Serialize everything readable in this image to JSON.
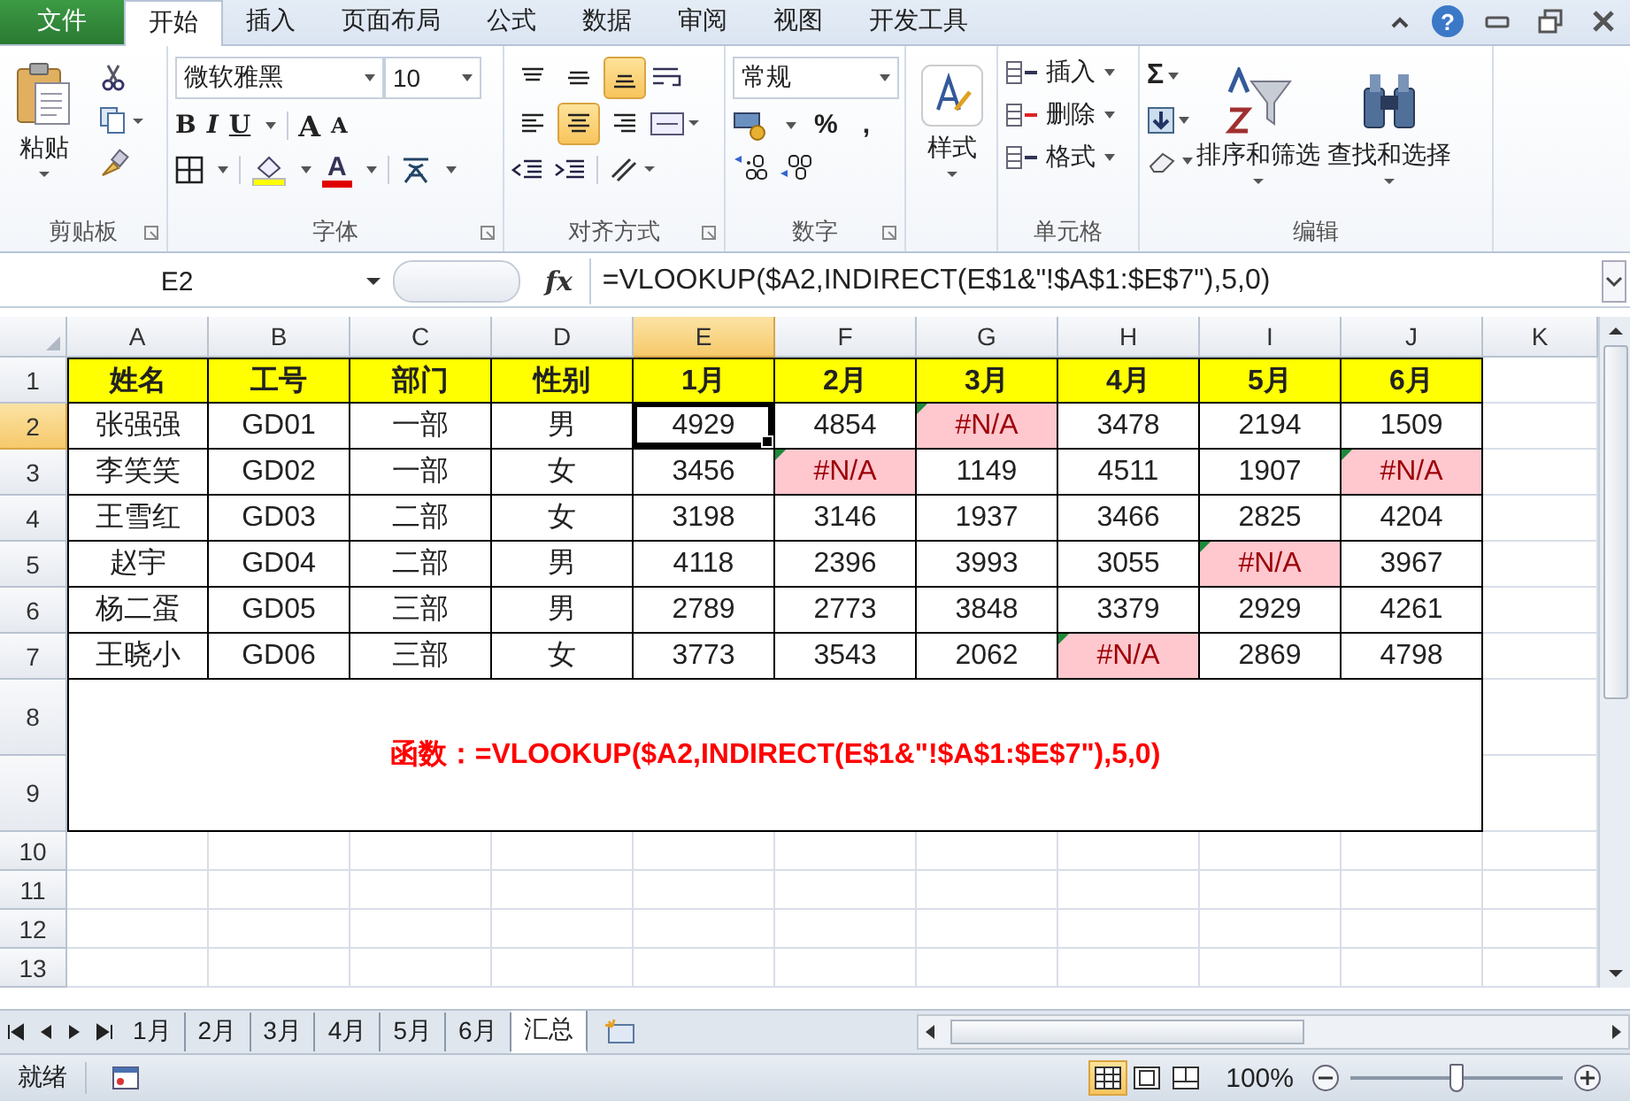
{
  "tabs": [
    {
      "label": "文件",
      "kind": "file",
      "selected": false
    },
    {
      "label": "开始",
      "kind": "tab",
      "selected": true
    },
    {
      "label": "插入",
      "kind": "tab",
      "selected": false
    },
    {
      "label": "页面布局",
      "kind": "tab",
      "selected": false
    },
    {
      "label": "公式",
      "kind": "tab",
      "selected": false
    },
    {
      "label": "数据",
      "kind": "tab",
      "selected": false
    },
    {
      "label": "审阅",
      "kind": "tab",
      "selected": false
    },
    {
      "label": "视图",
      "kind": "tab",
      "selected": false
    },
    {
      "label": "开发工具",
      "kind": "tab",
      "selected": false
    }
  ],
  "window_controls": {
    "help": "?"
  },
  "ribbon": {
    "clipboard": {
      "paste": "粘贴",
      "label": "剪贴板"
    },
    "font": {
      "name": "微软雅黑",
      "size": "10",
      "styles": [
        "B",
        "I",
        "U"
      ],
      "grow": "A",
      "shrink": "A",
      "font_color": "A",
      "label": "字体"
    },
    "alignment": {
      "buttons": [
        {
          "kind": "top",
          "selected": false
        },
        {
          "kind": "middle",
          "selected": false
        },
        {
          "kind": "bottom",
          "selected": true
        },
        {
          "kind": "left",
          "selected": false
        },
        {
          "kind": "center",
          "selected": true
        },
        {
          "kind": "right",
          "selected": false
        }
      ],
      "label": "对齐方式"
    },
    "number": {
      "format": "常规",
      "percent": "%",
      "comma": ",",
      "label": "数字"
    },
    "styles": {
      "button": "样式"
    },
    "cells": {
      "items": [
        "插入",
        "删除",
        "格式"
      ],
      "label": "单元格"
    },
    "editing": {
      "sum": "Σ",
      "sort": "排序和筛选",
      "find": "查找和选择",
      "label": "编辑"
    }
  },
  "formula_bar": {
    "name_box": "E2",
    "fx": "fx",
    "formula": "=VLOOKUP($A2,INDIRECT(E$1&\"!$A$1:$E$7\"),5,0)"
  },
  "sheet": {
    "columns": [
      {
        "label": "A",
        "selected": false
      },
      {
        "label": "B",
        "selected": false
      },
      {
        "label": "C",
        "selected": false
      },
      {
        "label": "D",
        "selected": false
      },
      {
        "label": "E",
        "selected": true
      },
      {
        "label": "F",
        "selected": false
      },
      {
        "label": "G",
        "selected": false
      },
      {
        "label": "H",
        "selected": false
      },
      {
        "label": "I",
        "selected": false
      },
      {
        "label": "J",
        "selected": false
      },
      {
        "label": "K",
        "selected": false
      }
    ],
    "rows": [
      {
        "number": "1",
        "kind": "header",
        "selected": false,
        "cells": [
          {
            "text": "姓名",
            "error": false
          },
          {
            "text": "工号",
            "error": false
          },
          {
            "text": "部门",
            "error": false
          },
          {
            "text": "性别",
            "error": false
          },
          {
            "text": "1月",
            "error": false
          },
          {
            "text": "2月",
            "error": false
          },
          {
            "text": "3月",
            "error": false
          },
          {
            "text": "4月",
            "error": false
          },
          {
            "text": "5月",
            "error": false
          },
          {
            "text": "6月",
            "error": false
          }
        ]
      },
      {
        "number": "2",
        "kind": "data",
        "selected": true,
        "cells": [
          {
            "text": "张强强",
            "error": false
          },
          {
            "text": "GD01",
            "error": false
          },
          {
            "text": "一部",
            "error": false
          },
          {
            "text": "男",
            "error": false
          },
          {
            "text": "4929",
            "error": false
          },
          {
            "text": "4854",
            "error": false
          },
          {
            "text": "#N/A",
            "error": true
          },
          {
            "text": "3478",
            "error": false
          },
          {
            "text": "2194",
            "error": false
          },
          {
            "text": "1509",
            "error": false
          }
        ]
      },
      {
        "number": "3",
        "kind": "data",
        "selected": false,
        "cells": [
          {
            "text": "李笑笑",
            "error": false
          },
          {
            "text": "GD02",
            "error": false
          },
          {
            "text": "一部",
            "error": false
          },
          {
            "text": "女",
            "error": false
          },
          {
            "text": "3456",
            "error": false
          },
          {
            "text": "#N/A",
            "error": true
          },
          {
            "text": "1149",
            "error": false
          },
          {
            "text": "4511",
            "error": false
          },
          {
            "text": "1907",
            "error": false
          },
          {
            "text": "#N/A",
            "error": true
          }
        ]
      },
      {
        "number": "4",
        "kind": "data",
        "selected": false,
        "cells": [
          {
            "text": "王雪红",
            "error": false
          },
          {
            "text": "GD03",
            "error": false
          },
          {
            "text": "二部",
            "error": false
          },
          {
            "text": "女",
            "error": false
          },
          {
            "text": "3198",
            "error": false
          },
          {
            "text": "3146",
            "error": false
          },
          {
            "text": "1937",
            "error": false
          },
          {
            "text": "3466",
            "error": false
          },
          {
            "text": "2825",
            "error": false
          },
          {
            "text": "4204",
            "error": false
          }
        ]
      },
      {
        "number": "5",
        "kind": "data",
        "selected": false,
        "cells": [
          {
            "text": "赵宇",
            "error": false
          },
          {
            "text": "GD04",
            "error": false
          },
          {
            "text": "二部",
            "error": false
          },
          {
            "text": "男",
            "error": false
          },
          {
            "text": "4118",
            "error": false
          },
          {
            "text": "2396",
            "error": false
          },
          {
            "text": "3993",
            "error": false
          },
          {
            "text": "3055",
            "error": false
          },
          {
            "text": "#N/A",
            "error": true
          },
          {
            "text": "3967",
            "error": false
          }
        ]
      },
      {
        "number": "6",
        "kind": "data",
        "selected": false,
        "cells": [
          {
            "text": "杨二蛋",
            "error": false
          },
          {
            "text": "GD05",
            "error": false
          },
          {
            "text": "三部",
            "error": false
          },
          {
            "text": "男",
            "error": false
          },
          {
            "text": "2789",
            "error": false
          },
          {
            "text": "2773",
            "error": false
          },
          {
            "text": "3848",
            "error": false
          },
          {
            "text": "3379",
            "error": false
          },
          {
            "text": "2929",
            "error": false
          },
          {
            "text": "4261",
            "error": false
          }
        ]
      },
      {
        "number": "7",
        "kind": "data",
        "selected": false,
        "cells": [
          {
            "text": "王晓小",
            "error": false
          },
          {
            "text": "GD06",
            "error": false
          },
          {
            "text": "三部",
            "error": false
          },
          {
            "text": "女",
            "error": false
          },
          {
            "text": "3773",
            "error": false
          },
          {
            "text": "3543",
            "error": false
          },
          {
            "text": "2062",
            "error": false
          },
          {
            "text": "#N/A",
            "error": true
          },
          {
            "text": "2869",
            "error": false
          },
          {
            "text": "4798",
            "error": false
          }
        ]
      }
    ],
    "note_rows": [
      {
        "number": "8",
        "selected": false
      },
      {
        "number": "9",
        "selected": false
      }
    ],
    "note": "函数：=VLOOKUP($A2,INDIRECT(E$1&\"!$A$1:$E$7\"),5,0)",
    "empty_rows": [
      {
        "number": "10",
        "selected": false
      },
      {
        "number": "11",
        "selected": false
      },
      {
        "number": "12",
        "selected": false
      },
      {
        "number": "13",
        "selected": false
      }
    ]
  },
  "sheet_tabs": [
    {
      "label": "1月",
      "selected": false
    },
    {
      "label": "2月",
      "selected": false
    },
    {
      "label": "3月",
      "selected": false
    },
    {
      "label": "4月",
      "selected": false
    },
    {
      "label": "5月",
      "selected": false
    },
    {
      "label": "6月",
      "selected": false
    },
    {
      "label": "汇总",
      "selected": true
    }
  ],
  "status_bar": {
    "ready": "就绪",
    "views": [
      {
        "kind": "normal",
        "selected": true
      },
      {
        "kind": "layout",
        "selected": false
      },
      {
        "kind": "pagebreak",
        "selected": false
      }
    ],
    "zoom": "100%",
    "zoom_slider": {
      "level": 0.5
    }
  }
}
